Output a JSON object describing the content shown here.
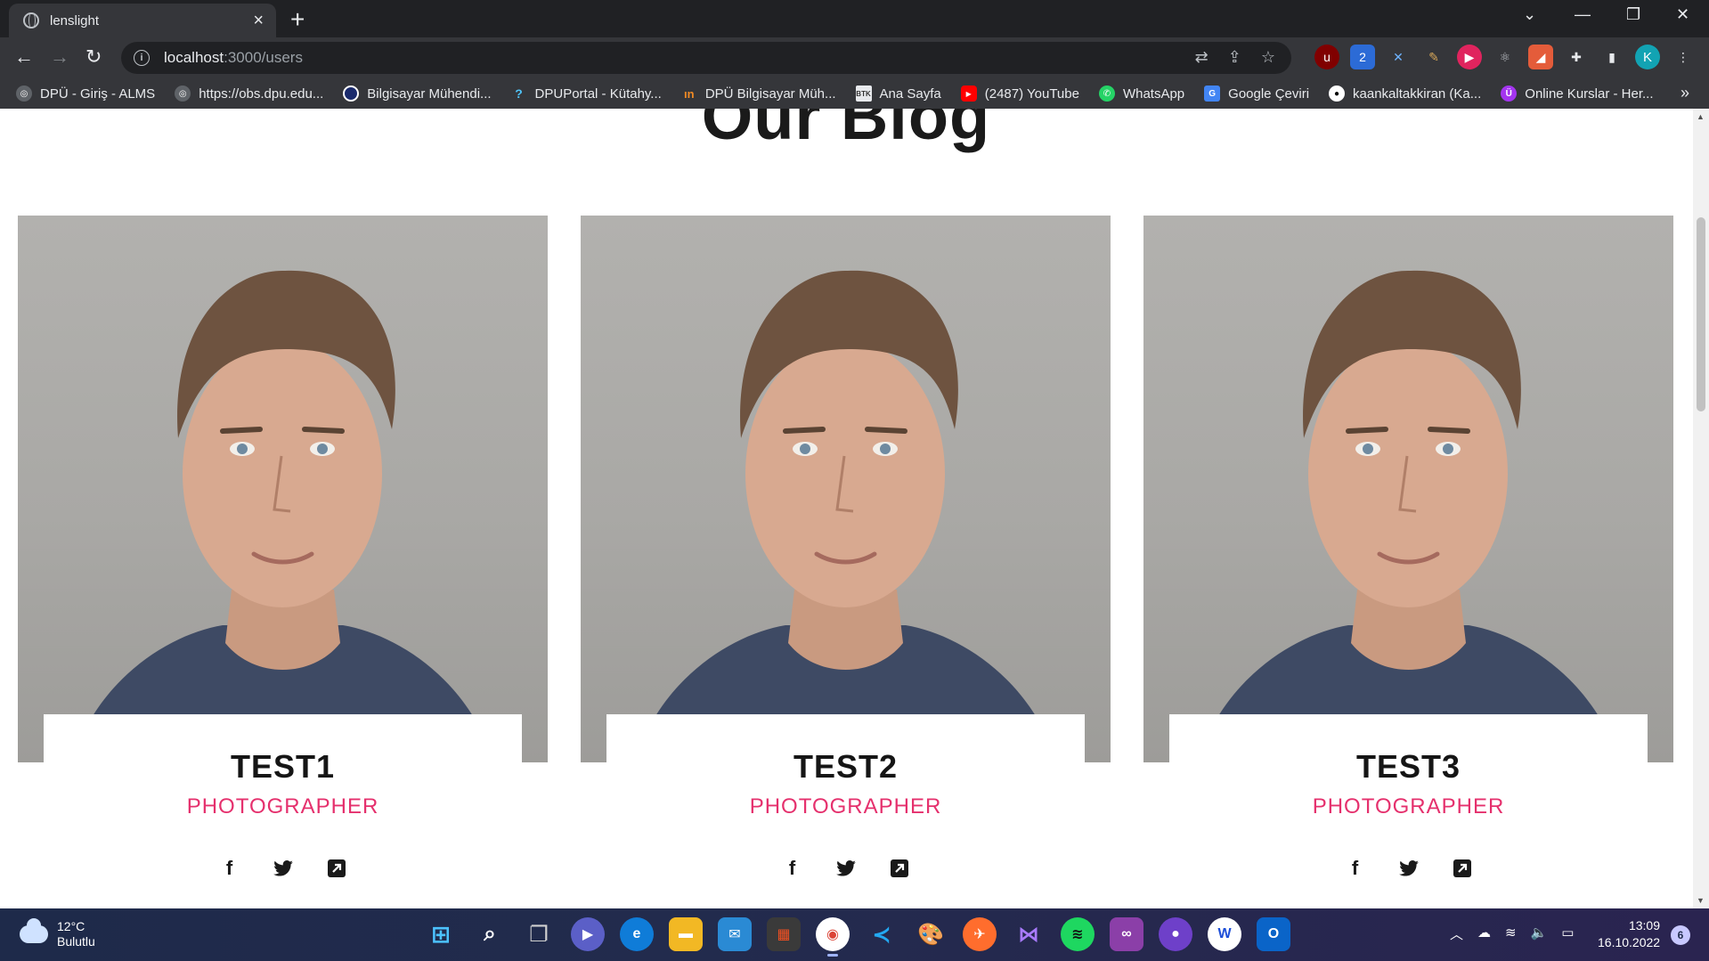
{
  "browser": {
    "tab_title": "lenslight",
    "url_host": "localhost",
    "url_path": ":3000/users",
    "profile_initial": "K"
  },
  "bookmarks": [
    {
      "label": "DPÜ - Giriş - ALMS",
      "icon": "globe-icon",
      "color": "#5f6368"
    },
    {
      "label": "https://obs.dpu.edu...",
      "icon": "globe-icon",
      "color": "#5f6368"
    },
    {
      "label": "Bilgisayar Mühendi...",
      "icon": "dpu-icon",
      "color": "#1a2a6c"
    },
    {
      "label": "DPUPortal - Kütahy...",
      "icon": "question-icon",
      "color": "#35363a"
    },
    {
      "label": "DPÜ Bilgisayar Müh...",
      "icon": "dpu-orange-icon",
      "color": "#c8620b"
    },
    {
      "label": "Ana Sayfa",
      "icon": "btk-icon",
      "color": "#4a4a4a"
    },
    {
      "label": "(2487) YouTube",
      "icon": "youtube-icon",
      "color": "#ff0000"
    },
    {
      "label": "WhatsApp",
      "icon": "whatsapp-icon",
      "color": "#25d366"
    },
    {
      "label": "Google Çeviri",
      "icon": "translate-icon",
      "color": "#4285f4"
    },
    {
      "label": "kaankaltakkiran (Ka...",
      "icon": "github-icon",
      "color": "#000000"
    },
    {
      "label": "Online Kurslar - Her...",
      "icon": "udemy-icon",
      "color": "#a435f0"
    }
  ],
  "page": {
    "heading": "Our Blog"
  },
  "team": [
    {
      "name": "TEST1",
      "role": "PHOTOGRAPHER"
    },
    {
      "name": "TEST2",
      "role": "PHOTOGRAPHER"
    },
    {
      "name": "TEST3",
      "role": "PHOTOGRAPHER"
    }
  ],
  "colors": {
    "accent": "#e5306d",
    "name": "#151515"
  },
  "taskbar": {
    "temperature": "12°C",
    "weather": "Bulutlu",
    "time": "13:09",
    "date": "16.10.2022",
    "notifications": "6"
  }
}
